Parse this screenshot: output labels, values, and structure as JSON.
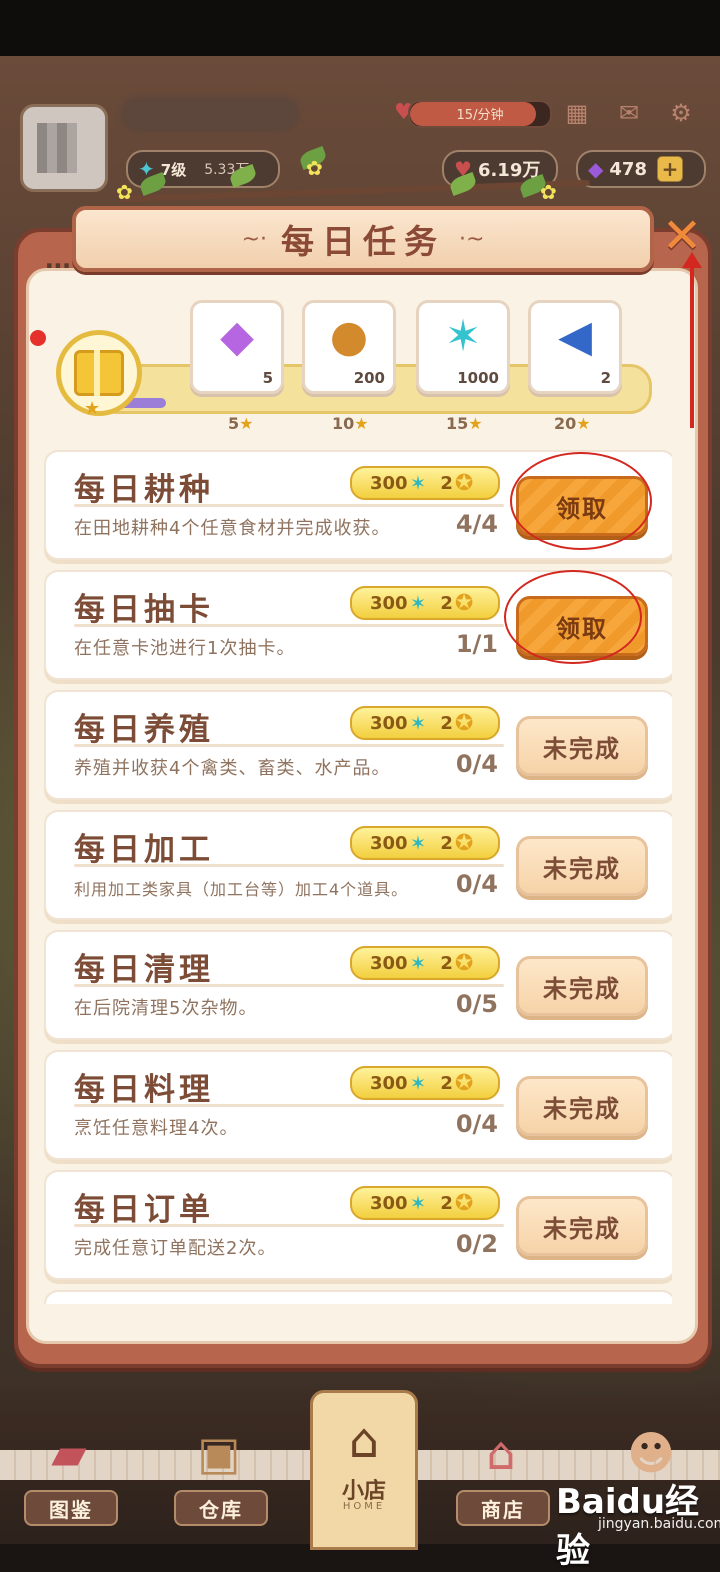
{
  "hud": {
    "energy_text": "15/分钟",
    "level": "7级",
    "level_value": "5.33万",
    "coins": "6.19万",
    "gems": "478",
    "plus": "+"
  },
  "panel": {
    "title": "每日任务",
    "close_icon": "close-icon"
  },
  "reward_track": {
    "rewards": [
      {
        "icon": "purple-gem-icon",
        "glyph": "💎",
        "count": "5"
      },
      {
        "icon": "gold-coin-icon",
        "glyph": "🪙",
        "count": "200"
      },
      {
        "icon": "star-crystal-icon",
        "glyph": "✦",
        "count": "1000"
      },
      {
        "icon": "megaphone-icon",
        "glyph": "📣",
        "count": "2"
      }
    ],
    "milestones": [
      "5",
      "10",
      "15",
      "20"
    ],
    "progress_fraction": 0.12
  },
  "tasks": [
    {
      "name": "每日耕种",
      "desc": "在田地耕种4个任意食材并完成收获。",
      "progress": "4/4",
      "reward_a": "300",
      "reward_b": "2",
      "button": "领取",
      "state": "claim"
    },
    {
      "name": "每日抽卡",
      "desc": "在任意卡池进行1次抽卡。",
      "progress": "1/1",
      "reward_a": "300",
      "reward_b": "2",
      "button": "领取",
      "state": "claim"
    },
    {
      "name": "每日养殖",
      "desc": "养殖并收获4个禽类、畜类、水产品。",
      "progress": "0/4",
      "reward_a": "300",
      "reward_b": "2",
      "button": "未完成",
      "state": "incomplete"
    },
    {
      "name": "每日加工",
      "desc": "利用加工类家具（加工台等）加工4个道具。",
      "progress": "0/4",
      "reward_a": "300",
      "reward_b": "2",
      "button": "未完成",
      "state": "incomplete"
    },
    {
      "name": "每日清理",
      "desc": "在后院清理5次杂物。",
      "progress": "0/5",
      "reward_a": "300",
      "reward_b": "2",
      "button": "未完成",
      "state": "incomplete"
    },
    {
      "name": "每日料理",
      "desc": "烹饪任意料理4次。",
      "progress": "0/4",
      "reward_a": "300",
      "reward_b": "2",
      "button": "未完成",
      "state": "incomplete"
    },
    {
      "name": "每日订单",
      "desc": "完成任意订单配送2次。",
      "progress": "0/2",
      "reward_a": "300",
      "reward_b": "2",
      "button": "未完成",
      "state": "incomplete"
    }
  ],
  "bottom_nav": {
    "items": [
      "图鉴",
      "仓库",
      "商店"
    ],
    "home_label": "小店",
    "home_sub": "HOME"
  },
  "watermark": {
    "main": "Baidu经验",
    "sub": "jingyan.baidu.com"
  },
  "colors": {
    "panel_frame": "#b7654d",
    "claim_button": "#f6a63a",
    "incomplete_button": "#f6d3a8",
    "annotation_red": "#d3271f"
  }
}
